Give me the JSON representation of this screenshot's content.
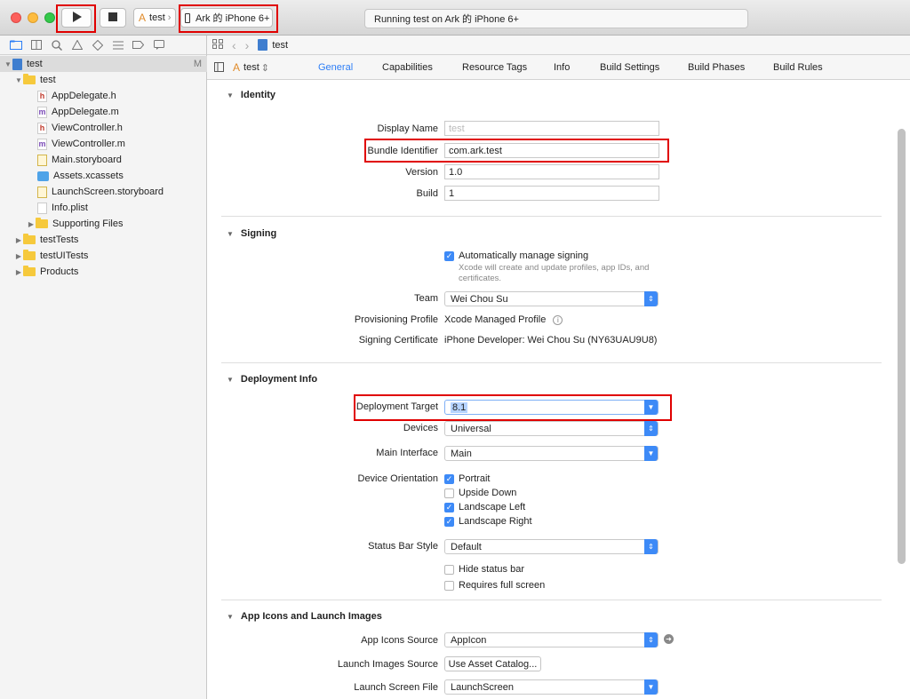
{
  "toolbar": {
    "run_icon": "play-icon",
    "stop_icon": "stop-icon",
    "scheme": "test",
    "device": "Ark 的 iPhone 6+",
    "activity": "Running test on Ark 的 iPhone 6+"
  },
  "navigator": {
    "tree": [
      {
        "label": "test",
        "badge": "M",
        "kind": "project"
      },
      {
        "label": "test",
        "kind": "folder"
      },
      {
        "label": "AppDelegate.h",
        "kind": "h"
      },
      {
        "label": "AppDelegate.m",
        "kind": "m"
      },
      {
        "label": "ViewController.h",
        "kind": "h"
      },
      {
        "label": "ViewController.m",
        "kind": "m"
      },
      {
        "label": "Main.storyboard",
        "kind": "storyboard"
      },
      {
        "label": "Assets.xcassets",
        "kind": "xcassets"
      },
      {
        "label": "LaunchScreen.storyboard",
        "kind": "storyboard"
      },
      {
        "label": "Info.plist",
        "kind": "plist"
      },
      {
        "label": "Supporting Files",
        "kind": "folder"
      },
      {
        "label": "testTests",
        "kind": "folder"
      },
      {
        "label": "testUITests",
        "kind": "folder"
      },
      {
        "label": "Products",
        "kind": "folder"
      }
    ]
  },
  "jumpbar": {
    "file": "test"
  },
  "tabs": {
    "target": "test",
    "items": [
      "General",
      "Capabilities",
      "Resource Tags",
      "Info",
      "Build Settings",
      "Build Phases",
      "Build Rules"
    ],
    "active": "General"
  },
  "identity": {
    "title": "Identity",
    "display_name_label": "Display Name",
    "display_name_placeholder": "test",
    "bundle_id_label": "Bundle Identifier",
    "bundle_id": "com.ark.test",
    "version_label": "Version",
    "version": "1.0",
    "build_label": "Build",
    "build": "1"
  },
  "signing": {
    "title": "Signing",
    "auto_label": "Automatically manage signing",
    "auto_note": "Xcode will create and update profiles, app IDs, and certificates.",
    "auto_checked": true,
    "team_label": "Team",
    "team": "Wei Chou Su",
    "profile_label": "Provisioning Profile",
    "profile": "Xcode Managed Profile",
    "cert_label": "Signing Certificate",
    "cert": "iPhone Developer: Wei Chou Su (NY63UAU9U8)"
  },
  "deployment": {
    "title": "Deployment Info",
    "target_label": "Deployment Target",
    "target": "8.1",
    "devices_label": "Devices",
    "devices": "Universal",
    "main_interface_label": "Main Interface",
    "main_interface": "Main",
    "orientation_label": "Device Orientation",
    "orientations": [
      {
        "label": "Portrait",
        "checked": true
      },
      {
        "label": "Upside Down",
        "checked": false
      },
      {
        "label": "Landscape Left",
        "checked": true
      },
      {
        "label": "Landscape Right",
        "checked": true
      }
    ],
    "status_bar_label": "Status Bar Style",
    "status_bar": "Default",
    "hide_status_bar": "Hide status bar",
    "full_screen": "Requires full screen"
  },
  "icons": {
    "title": "App Icons and Launch Images",
    "icons_source_label": "App Icons Source",
    "icons_source": "AppIcon",
    "launch_images_label": "Launch Images Source",
    "launch_images_button": "Use Asset Catalog...",
    "launch_file_label": "Launch Screen File",
    "launch_file": "LaunchScreen"
  },
  "colors": {
    "accent": "#3d8af7",
    "highlight": "#e00000"
  }
}
